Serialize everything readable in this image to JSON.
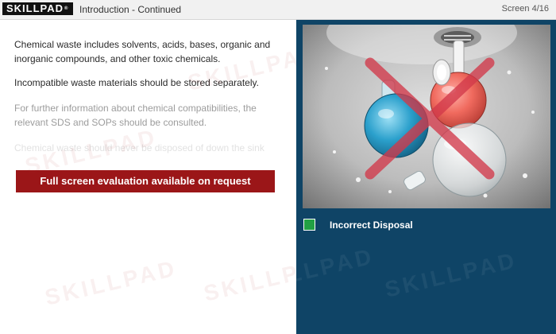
{
  "topbar": {
    "logo_text": "SKILLPAD",
    "logo_registered": "®",
    "title": "Introduction - Continued",
    "screen_counter": "Screen 4/16"
  },
  "content": {
    "paragraphs": [
      "Chemical waste includes solvents, acids, bases, organic and inorganic compounds, and other toxic chemicals.",
      "Incompatible waste materials should be stored separately.",
      "For further information about chemical compatibilities, the relevant SDS and SOPs should be consulted.",
      "Chemical waste should never be disposed of down the sink"
    ],
    "eval_banner": "Full screen evaluation available on request"
  },
  "panel": {
    "caption": "Incorrect Disposal",
    "checkbox_checked": true,
    "image_icon": "flasks-in-sink-image",
    "overlay_icon": "red-x-icon",
    "colors": {
      "panel_bg": "#0f4466",
      "checkbox": "#22a044",
      "x_mark": "#d2394a",
      "banner": "#9b1618"
    }
  }
}
